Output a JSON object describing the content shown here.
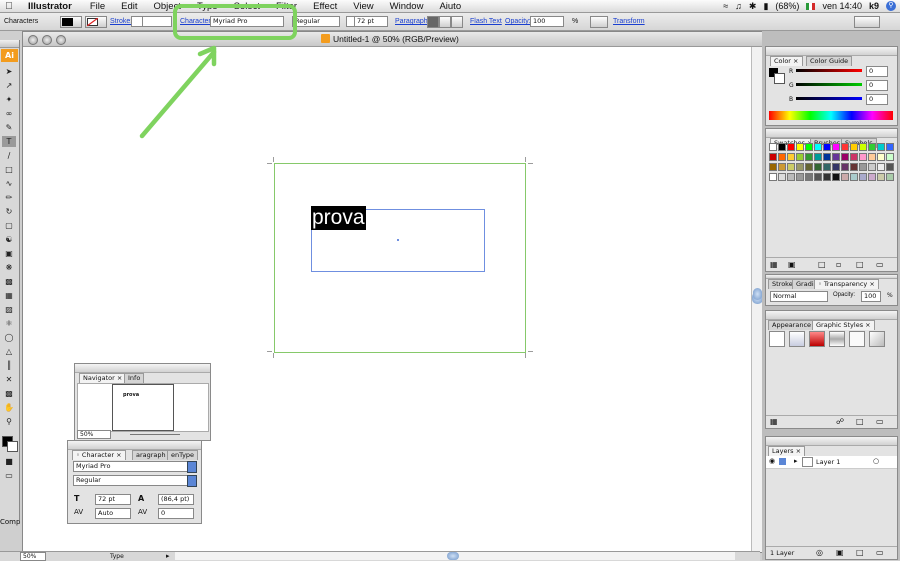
{
  "menubar": {
    "app_name": "Illustrator",
    "items": [
      "File",
      "Edit",
      "Object",
      "Type",
      "Select",
      "Filter",
      "Effect",
      "View",
      "Window",
      "Aiuto"
    ],
    "battery": "(68%)",
    "clock": "ven 14:40",
    "user": "k9"
  },
  "control_bar": {
    "mode_label": "Characters",
    "stroke_label": "Stroke:",
    "character_label": "Character:",
    "font_name": "Myriad Pro",
    "font_style": "Regular",
    "font_size": "72 pt",
    "paragraph_label": "Paragraph:",
    "flash_text_label": "Flash Text",
    "opacity_label": "Opacity:",
    "opacity_value": "100",
    "opacity_unit": "%",
    "transform_label": "Transform"
  },
  "document": {
    "title": "Untitled-1 @ 50% (RGB/Preview)",
    "selected_text": "prova"
  },
  "navigator": {
    "tabs": [
      "Navigator",
      "Info"
    ],
    "preview_text": "prova",
    "zoom": "50%"
  },
  "character_panel": {
    "tabs": [
      "Character",
      "aragraph",
      "enType"
    ],
    "font_name": "Myriad Pro",
    "font_style": "Regular",
    "size": "72 pt",
    "leading": "(86,4 pt)",
    "kerning": "Auto",
    "tracking": "0"
  },
  "color_panel": {
    "tabs": [
      "Color",
      "Color Guide"
    ],
    "channels": [
      {
        "label": "R",
        "value": "0"
      },
      {
        "label": "G",
        "value": "0"
      },
      {
        "label": "B",
        "value": "0"
      }
    ]
  },
  "swatches_panel": {
    "tabs": [
      "Swatches",
      "Brushes",
      "Symbols"
    ]
  },
  "transparency_panel": {
    "tabs": [
      "Stroke",
      "Gradi",
      "Transparency"
    ],
    "blend_mode": "Normal",
    "opacity_label": "Opacity:",
    "opacity_value": "100",
    "opacity_unit": "%"
  },
  "appearance_panel": {
    "tabs": [
      "Appearance",
      "Graphic Styles"
    ]
  },
  "layers_panel": {
    "tabs": [
      "Layers"
    ],
    "layer_name": "Layer 1",
    "count": "1 Layer"
  },
  "statusbar": {
    "zoom": "50%",
    "tool": "Type"
  },
  "toolbox": {
    "truncated_label": "Comp"
  },
  "colors": {
    "annotation_green": "#7fd35f",
    "artboard_green": "#86c96a",
    "selection_blue": "#6f8fe0",
    "link_blue": "#1a3fd0"
  }
}
